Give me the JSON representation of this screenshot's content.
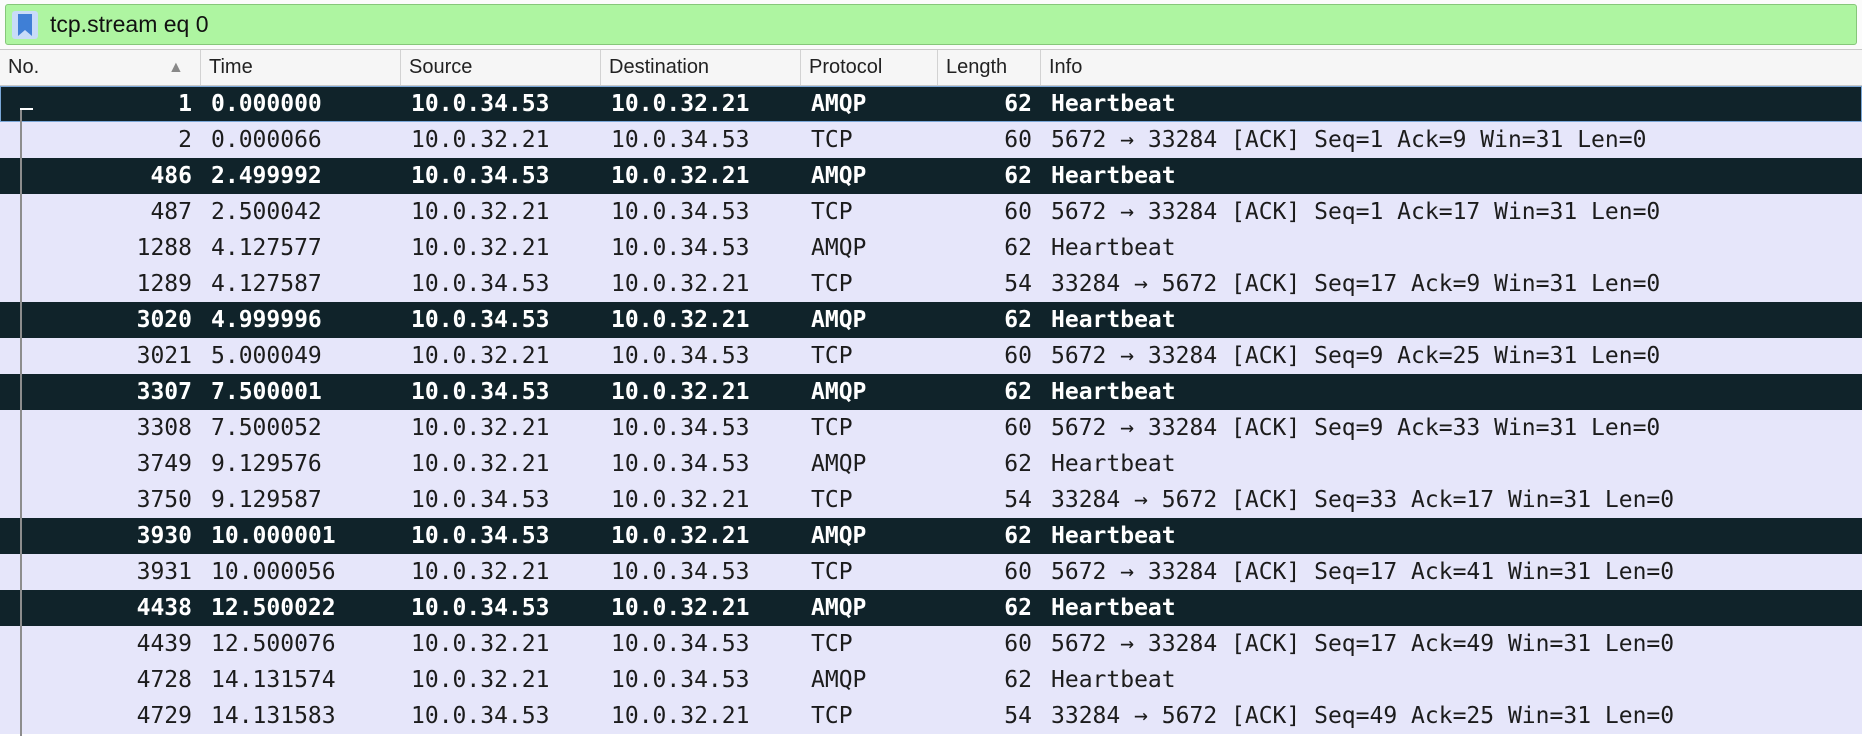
{
  "filter": {
    "value": "tcp.stream eq 0"
  },
  "columns": [
    "No.",
    "Time",
    "Source",
    "Destination",
    "Protocol",
    "Length",
    "Info"
  ],
  "icons": {
    "bookmark": "bookmark-icon",
    "sort": "sort-ascending-icon"
  },
  "colors": {
    "filter_valid": "#aef5a1",
    "row_default": "#e6e6fa",
    "row_marked": "#10232a"
  },
  "rows": [
    {
      "no": "1",
      "time": "0.000000",
      "source": "10.0.34.53",
      "destination": "10.0.32.21",
      "protocol": "AMQP",
      "length": "62",
      "info": "Heartbeat",
      "style": "dark"
    },
    {
      "no": "2",
      "time": "0.000066",
      "source": "10.0.32.21",
      "destination": "10.0.34.53",
      "protocol": "TCP",
      "length": "60",
      "info": "5672 → 33284 [ACK] Seq=1 Ack=9 Win=31 Len=0",
      "style": "light"
    },
    {
      "no": "486",
      "time": "2.499992",
      "source": "10.0.34.53",
      "destination": "10.0.32.21",
      "protocol": "AMQP",
      "length": "62",
      "info": "Heartbeat",
      "style": "dark"
    },
    {
      "no": "487",
      "time": "2.500042",
      "source": "10.0.32.21",
      "destination": "10.0.34.53",
      "protocol": "TCP",
      "length": "60",
      "info": "5672 → 33284 [ACK] Seq=1 Ack=17 Win=31 Len=0",
      "style": "light"
    },
    {
      "no": "1288",
      "time": "4.127577",
      "source": "10.0.32.21",
      "destination": "10.0.34.53",
      "protocol": "AMQP",
      "length": "62",
      "info": "Heartbeat",
      "style": "light"
    },
    {
      "no": "1289",
      "time": "4.127587",
      "source": "10.0.34.53",
      "destination": "10.0.32.21",
      "protocol": "TCP",
      "length": "54",
      "info": "33284 → 5672 [ACK] Seq=17 Ack=9 Win=31 Len=0",
      "style": "light"
    },
    {
      "no": "3020",
      "time": "4.999996",
      "source": "10.0.34.53",
      "destination": "10.0.32.21",
      "protocol": "AMQP",
      "length": "62",
      "info": "Heartbeat",
      "style": "dark"
    },
    {
      "no": "3021",
      "time": "5.000049",
      "source": "10.0.32.21",
      "destination": "10.0.34.53",
      "protocol": "TCP",
      "length": "60",
      "info": "5672 → 33284 [ACK] Seq=9 Ack=25 Win=31 Len=0",
      "style": "light"
    },
    {
      "no": "3307",
      "time": "7.500001",
      "source": "10.0.34.53",
      "destination": "10.0.32.21",
      "protocol": "AMQP",
      "length": "62",
      "info": "Heartbeat",
      "style": "dark"
    },
    {
      "no": "3308",
      "time": "7.500052",
      "source": "10.0.32.21",
      "destination": "10.0.34.53",
      "protocol": "TCP",
      "length": "60",
      "info": "5672 → 33284 [ACK] Seq=9 Ack=33 Win=31 Len=0",
      "style": "light"
    },
    {
      "no": "3749",
      "time": "9.129576",
      "source": "10.0.32.21",
      "destination": "10.0.34.53",
      "protocol": "AMQP",
      "length": "62",
      "info": "Heartbeat",
      "style": "light"
    },
    {
      "no": "3750",
      "time": "9.129587",
      "source": "10.0.34.53",
      "destination": "10.0.32.21",
      "protocol": "TCP",
      "length": "54",
      "info": "33284 → 5672 [ACK] Seq=33 Ack=17 Win=31 Len=0",
      "style": "light"
    },
    {
      "no": "3930",
      "time": "10.000001",
      "source": "10.0.34.53",
      "destination": "10.0.32.21",
      "protocol": "AMQP",
      "length": "62",
      "info": "Heartbeat",
      "style": "dark"
    },
    {
      "no": "3931",
      "time": "10.000056",
      "source": "10.0.32.21",
      "destination": "10.0.34.53",
      "protocol": "TCP",
      "length": "60",
      "info": "5672 → 33284 [ACK] Seq=17 Ack=41 Win=31 Len=0",
      "style": "light"
    },
    {
      "no": "4438",
      "time": "12.500022",
      "source": "10.0.34.53",
      "destination": "10.0.32.21",
      "protocol": "AMQP",
      "length": "62",
      "info": "Heartbeat",
      "style": "dark"
    },
    {
      "no": "4439",
      "time": "12.500076",
      "source": "10.0.32.21",
      "destination": "10.0.34.53",
      "protocol": "TCP",
      "length": "60",
      "info": "5672 → 33284 [ACK] Seq=17 Ack=49 Win=31 Len=0",
      "style": "light"
    },
    {
      "no": "4728",
      "time": "14.131574",
      "source": "10.0.32.21",
      "destination": "10.0.34.53",
      "protocol": "AMQP",
      "length": "62",
      "info": "Heartbeat",
      "style": "light"
    },
    {
      "no": "4729",
      "time": "14.131583",
      "source": "10.0.34.53",
      "destination": "10.0.32.21",
      "protocol": "TCP",
      "length": "54",
      "info": "33284 → 5672 [ACK] Seq=49 Ack=25 Win=31 Len=0",
      "style": "light"
    }
  ]
}
